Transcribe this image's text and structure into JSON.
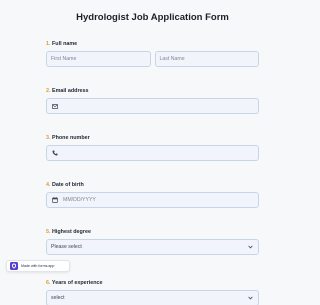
{
  "form": {
    "title": "Hydrologist Job Application Form",
    "questions": [
      {
        "number": "1.",
        "label": "Full name",
        "first_placeholder": "First Name",
        "last_placeholder": "Last Name"
      },
      {
        "number": "2.",
        "label": "Email address",
        "icon": "envelope-icon"
      },
      {
        "number": "3.",
        "label": "Phone number",
        "icon": "phone-icon"
      },
      {
        "number": "4.",
        "label": "Date of birth",
        "icon": "calendar-icon",
        "placeholder": "MM/DD/YYYY"
      },
      {
        "number": "5.",
        "label": "Highest degree",
        "value": "Please select"
      },
      {
        "number": "6.",
        "label": "Years of experience",
        "value": "select"
      }
    ]
  },
  "badge": {
    "text": "Made with forms.app",
    "icon": "forms-app-logo-icon"
  },
  "colors": {
    "accent_number": "#d89b3c",
    "field_bg": "#f1f5fb",
    "field_border": "#c7d5e7",
    "page_bg": "#f7f8fa"
  }
}
